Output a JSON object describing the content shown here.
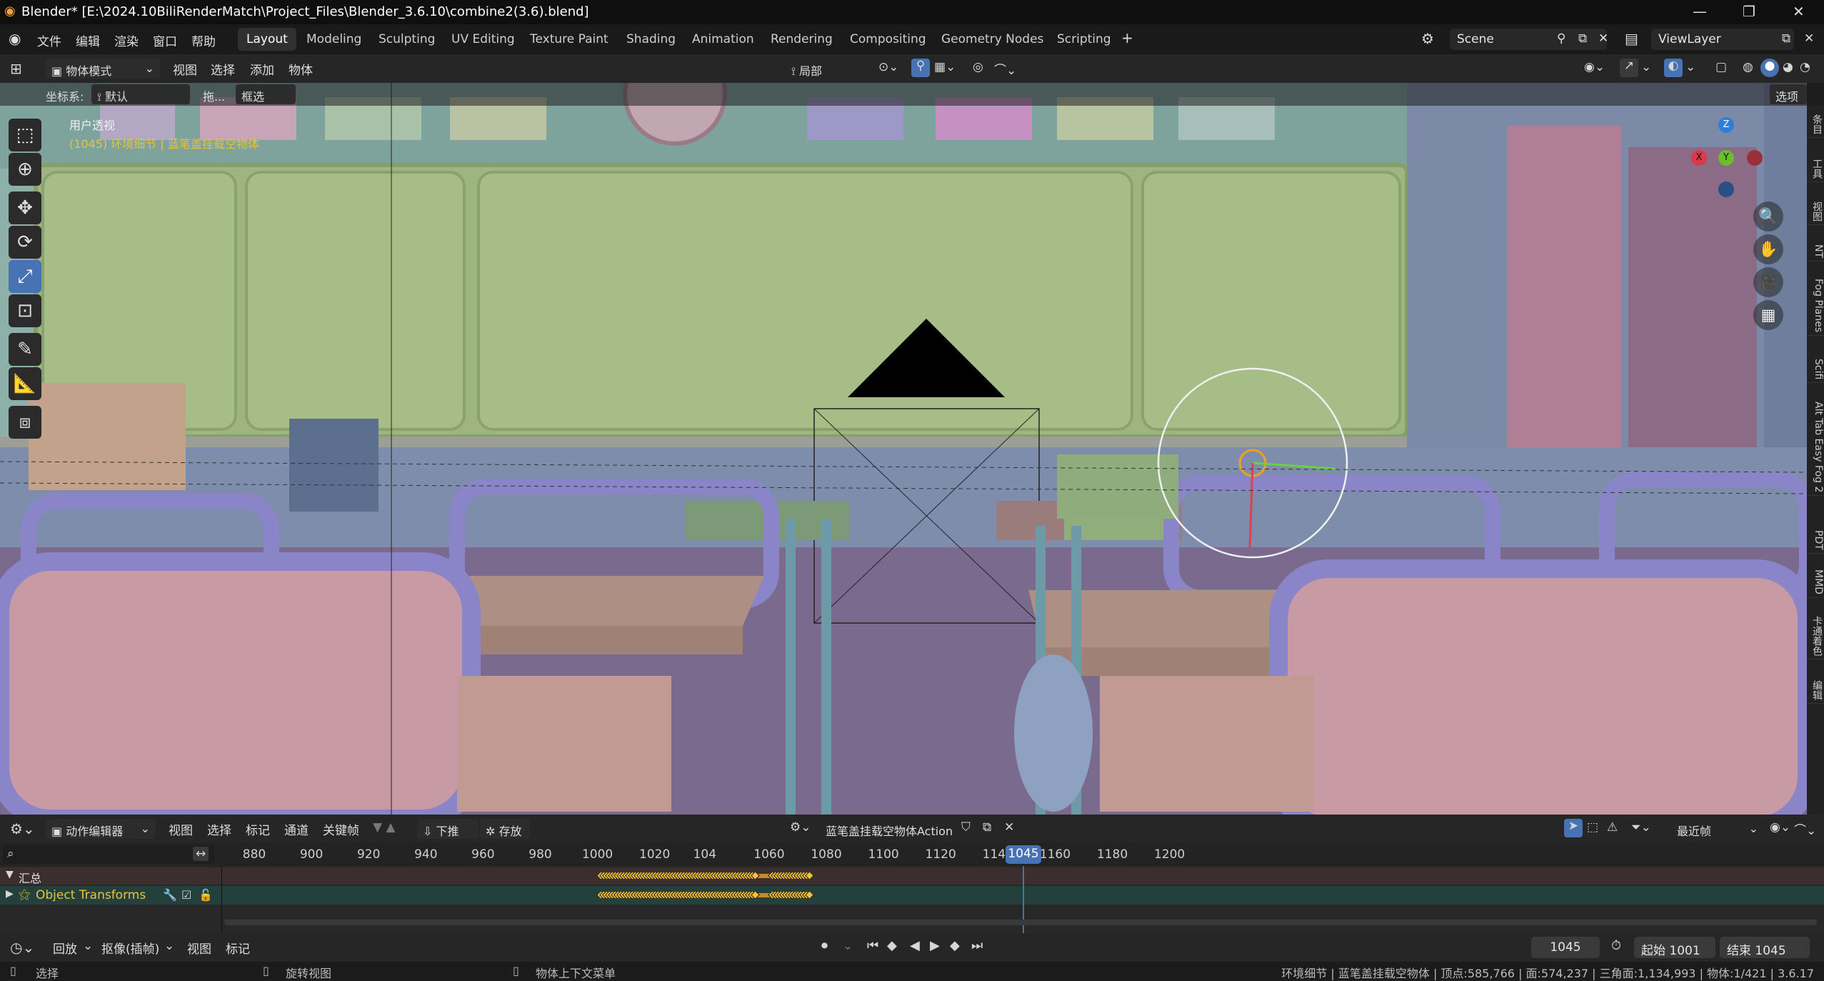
{
  "window": {
    "title": "Blender* [E:\\2024.10BiliRenderMatch\\Project_Files\\Blender_3.6.10\\combine2(3.6).blend]",
    "controls": [
      "—",
      "❐",
      "✕"
    ]
  },
  "menu": {
    "items": [
      "文件",
      "编辑",
      "渲染",
      "窗口",
      "帮助"
    ]
  },
  "workspaces": [
    "Layout",
    "Modeling",
    "Sculpting",
    "UV Editing",
    "Texture Paint",
    "Shading",
    "Animation",
    "Rendering",
    "Compositing",
    "Geometry Nodes",
    "Scripting"
  ],
  "active_workspace": "Layout",
  "scene": "Scene",
  "view_layer": "ViewLayer",
  "viewport_header": {
    "mode": "物体模式",
    "menus": [
      "视图",
      "选择",
      "添加",
      "物体"
    ],
    "pivot": "局部",
    "orientation_label": "坐标系:",
    "orientation": "默认",
    "drag_label": "拖...",
    "drag_value": "框选",
    "options": "选项"
  },
  "viewport": {
    "view_name": "用户透视",
    "info": "(1045) 环境细节 | 蓝笔盖挂载空物体",
    "gizmo": {
      "z": "Z",
      "y": "Y",
      "x": "X"
    }
  },
  "sidebar_tabs": [
    "条目",
    "工具",
    "视图",
    "NT",
    "Fog Planes",
    "Scifi",
    "Alt Tab Easy Fog 2",
    "PDT",
    "MMD",
    "卡通着色",
    "编辑"
  ],
  "dopesheet": {
    "mode": "动作编辑器",
    "menus": [
      "视图",
      "选择",
      "标记",
      "通道",
      "关键帧"
    ],
    "push_down": "下推",
    "stash": "存放",
    "action": "蓝笔盖挂载空物体Action",
    "snap": "最近帧",
    "ruler": [
      880,
      900,
      920,
      940,
      960,
      980,
      1000,
      1020,
      1040,
      1060,
      1080,
      1100,
      1120,
      1140,
      1160,
      1180,
      1200
    ],
    "current_frame_label": "1045",
    "channels": [
      {
        "name": "汇总"
      },
      {
        "name": "Object Transforms"
      }
    ]
  },
  "timeline": {
    "menus": [
      "回放",
      "抠像(插帧)",
      "视图",
      "标记"
    ],
    "current": "1045",
    "start_label": "起始",
    "start": "1001",
    "end_label": "结束",
    "end": "1045"
  },
  "status": {
    "select": "选择",
    "rotate": "旋转视图",
    "context": "物体上下文菜单",
    "stats": "环境细节 | 蓝笔盖挂载空物体 | 顶点:585,766 | 面:574,237 | 三角面:1,134,993 | 物体:1/421 | 3.6.17"
  },
  "colors": {
    "accent": "#4772b3",
    "keyframe": "#f0c040",
    "playhead": "#4772b3",
    "info_text": "#e8c23c"
  }
}
